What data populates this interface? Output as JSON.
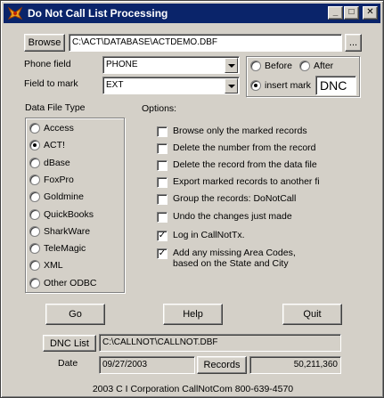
{
  "window": {
    "title": "Do Not Call List Processing",
    "controls": {
      "minimize": "_",
      "maximize": "□",
      "close": "✕"
    }
  },
  "browse": {
    "button_label": "Browse",
    "path": "C:\\ACT\\DATABASE\\ACTDEMO.DBF",
    "ellipsis_label": "..."
  },
  "phone_field": {
    "label": "Phone field",
    "value": "PHONE"
  },
  "field_to_mark": {
    "label": "Field to mark",
    "value": "EXT"
  },
  "position": {
    "before_label": "Before",
    "after_label": "After",
    "insert_label": "insert mark",
    "mark_value": "DNC",
    "selected": "insert"
  },
  "data_file_type": {
    "label": "Data File Type",
    "selected": "ACT!",
    "options": [
      "Access",
      "ACT!",
      "dBase",
      "FoxPro",
      "Goldmine",
      "QuickBooks",
      "SharkWare",
      "TeleMagic",
      "XML",
      "Other ODBC"
    ]
  },
  "options": {
    "label": "Options:",
    "items": [
      {
        "label": "Browse only the marked records",
        "checked": false
      },
      {
        "label": "Delete the number from the record",
        "checked": false
      },
      {
        "label": "Delete the record from the data file",
        "checked": false
      },
      {
        "label": "Export marked records to another fi",
        "checked": false
      },
      {
        "label": "Group the records: DoNotCall",
        "checked": false
      },
      {
        "label": "Undo the changes just made",
        "checked": false
      },
      {
        "label": "Log in CallNotTx.",
        "checked": true
      },
      {
        "label": "Add any missing Area Codes,",
        "label2": "based on the State and City",
        "checked": true
      }
    ]
  },
  "actions": {
    "go": "Go",
    "help": "Help",
    "quit": "Quit"
  },
  "dnc_list": {
    "button_label": "DNC List",
    "path": "C:\\CALLNOT\\CALLNOT.DBF"
  },
  "date": {
    "label": "Date",
    "value": "09/27/2003"
  },
  "records": {
    "button_label": "Records",
    "value": "50,211,360"
  },
  "footer": {
    "text": "2003 C I Corporation   CallNotCom   800-639-4570"
  },
  "colors": {
    "titlebar": "#0a246a",
    "face": "#d4d0c8"
  }
}
